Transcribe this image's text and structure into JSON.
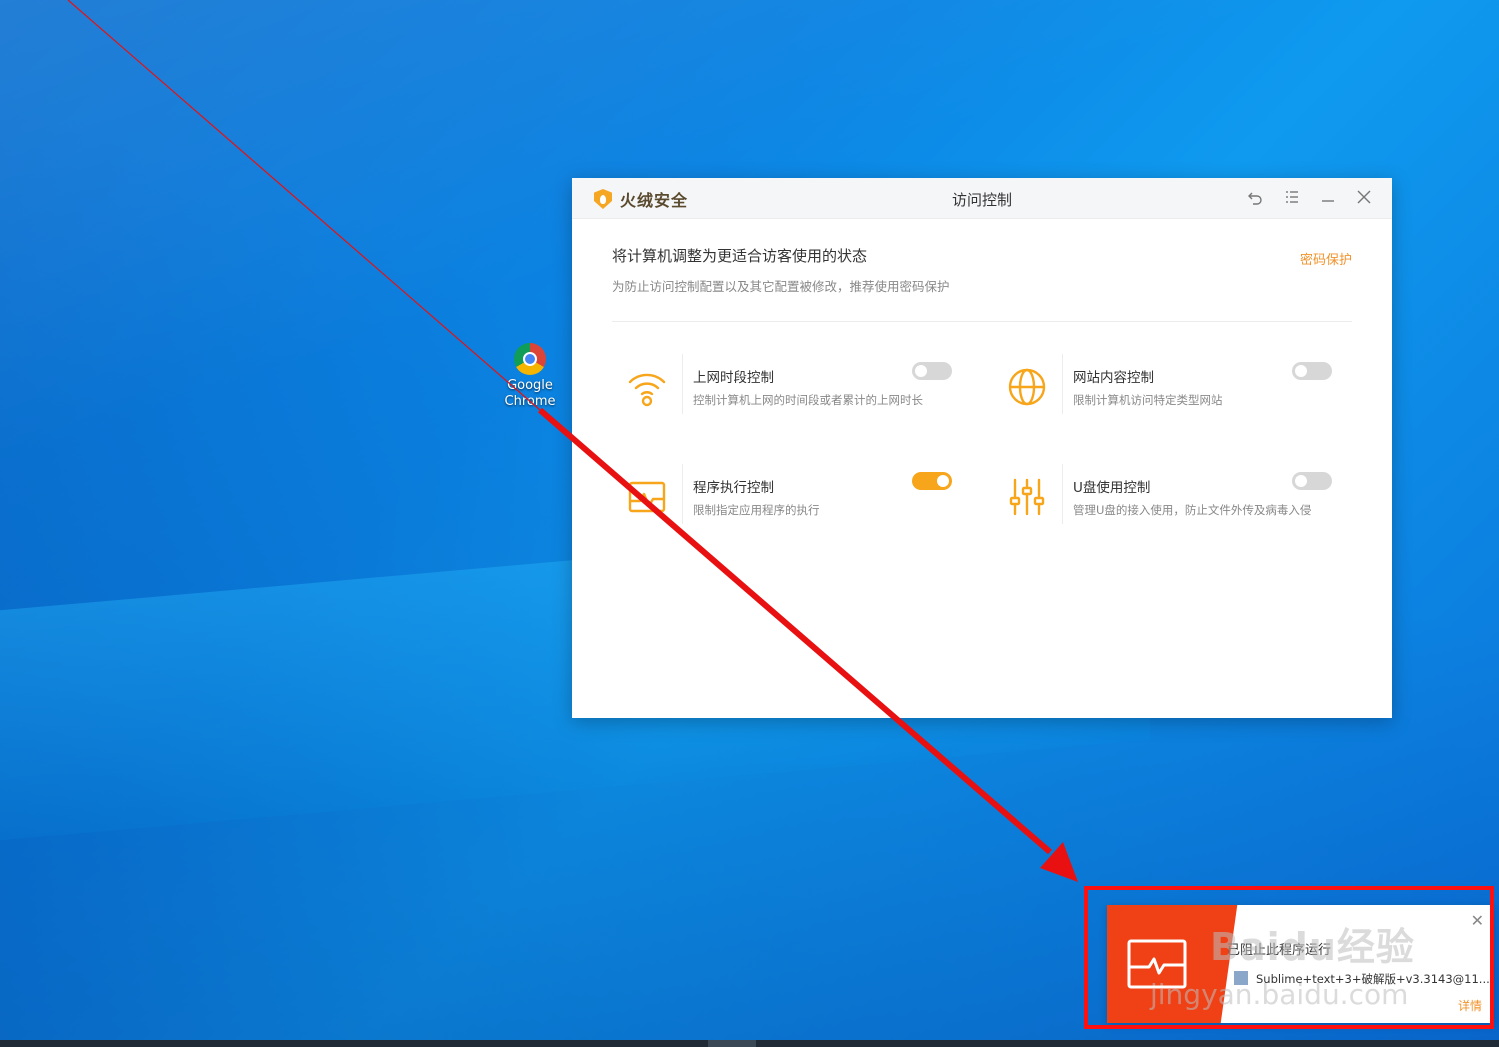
{
  "desktop": {
    "icons": [
      {
        "label": "Google Chrome"
      }
    ]
  },
  "app": {
    "brand": "火绒安全",
    "title": "访问控制",
    "controls": {
      "back_icon": "undo-icon",
      "menu_icon": "list-menu-icon",
      "minimize_icon": "minimize-icon",
      "close_icon": "close-icon"
    },
    "headline": "将计算机调整为更适合访客使用的状态",
    "subline": "为防止访问控制配置以及其它配置被修改，推荐使用密码保护",
    "password_link": "密码保护",
    "accent_color": "#f7a51a",
    "features": [
      {
        "name": "上网时段控制",
        "desc": "控制计算机上网的时间段或者累计的上网时长",
        "icon": "wifi-icon",
        "enabled": false
      },
      {
        "name": "网站内容控制",
        "desc": "限制计算机访问特定类型网站",
        "icon": "globe-icon",
        "enabled": false
      },
      {
        "name": "程序执行控制",
        "desc": "限制指定应用程序的执行",
        "icon": "program-monitor-icon",
        "enabled": true
      },
      {
        "name": "U盘使用控制",
        "desc": "管理U盘的接入使用，防止文件外传及病毒入侵",
        "icon": "sliders-icon",
        "enabled": false
      }
    ]
  },
  "notification": {
    "title": "已阻止此程序运行",
    "detail": "Sublime+text+3+破解版+v3.3143@11...",
    "more_label": "详情",
    "side_color": "#f04016",
    "icon": "program-blocked-icon",
    "close_icon": "close-icon"
  },
  "watermark": {
    "main": "Baidu经验",
    "sub": "jingyan.baidu.com"
  }
}
